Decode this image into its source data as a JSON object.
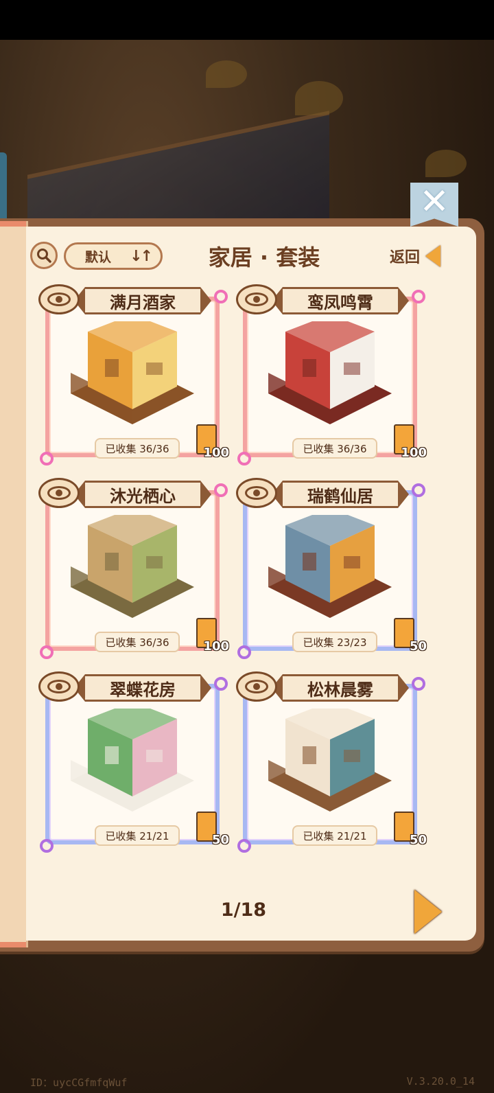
{
  "header": {
    "search_icon": "search-icon",
    "sort_label": "默认",
    "sort_icon": "sort-icon",
    "title": "家居 · 套装",
    "back_label": "返回",
    "close_icon": "close-icon"
  },
  "sets": [
    {
      "name": "满月酒家",
      "collected": "已收集 36/36",
      "reward": "100",
      "frame": "pink",
      "palette": [
        "#e9a13a",
        "#8a5327",
        "#f3d27a"
      ]
    },
    {
      "name": "鸾凤鸣霄",
      "collected": "已收集 36/36",
      "reward": "100",
      "frame": "pink",
      "palette": [
        "#c8423a",
        "#7a2a22",
        "#f4efe8"
      ]
    },
    {
      "name": "沐光栖心",
      "collected": "已收集 36/36",
      "reward": "100",
      "frame": "pink",
      "palette": [
        "#c9a46b",
        "#7a6a40",
        "#a8b56a"
      ]
    },
    {
      "name": "瑞鹤仙居",
      "collected": "已收集 23/23",
      "reward": "50",
      "frame": "blue",
      "palette": [
        "#6f8fa6",
        "#7a3a24",
        "#e6a040"
      ]
    },
    {
      "name": "翠蝶花房",
      "collected": "已收集 21/21",
      "reward": "50",
      "frame": "blue",
      "palette": [
        "#6fae6a",
        "#f1ece2",
        "#e9b7c4"
      ]
    },
    {
      "name": "松林晨雾",
      "collected": "已收集 21/21",
      "reward": "50",
      "frame": "blue",
      "palette": [
        "#f1e3cf",
        "#8a5a36",
        "#5f8f96"
      ]
    }
  ],
  "pagination": {
    "label": "1/18",
    "next_icon": "next-arrow-icon"
  },
  "footer": {
    "user_id": "ID：uycCGfmfqWuf",
    "version": "V.3.20.0_14"
  }
}
